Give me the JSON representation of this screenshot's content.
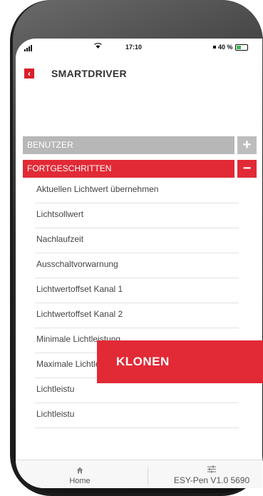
{
  "status_bar": {
    "time": "17:10",
    "battery_text": "40 %",
    "battery_level": 0.4,
    "wifi_icon": "wifi-icon",
    "signal_icon": "signal-icon"
  },
  "header": {
    "back_icon": "back-arrow-icon",
    "back_glyph": "‹",
    "title": "SMARTDRIVER"
  },
  "sections": [
    {
      "label": "BENUTZER",
      "toggle": "+",
      "state": "collapsed",
      "color": "#b7b7b7"
    },
    {
      "label": "FORTGESCHRITTEN",
      "toggle": "−",
      "state": "expanded",
      "color": "#e12a36"
    }
  ],
  "list_items": [
    "Aktuellen Lichtwert übernehmen",
    "Lichtsollwert",
    "Nachlaufzeit",
    "Ausschaltvorwarnung",
    "Lichtwertoffset Kanal 1",
    "Lichtwertoffset Kanal 2",
    "Minimale Lichtleistung",
    "Maximale Lichtleistung",
    "Lichtleistu",
    "Lichtleistu"
  ],
  "overlay": {
    "label": "KLONEN",
    "color": "#e12a36"
  },
  "bottom_bar": {
    "home_label": "Home",
    "home_icon": "home-icon",
    "device_label": "ESY-Pen V1.0 5690",
    "device_icon": "settings-sliders-icon"
  }
}
